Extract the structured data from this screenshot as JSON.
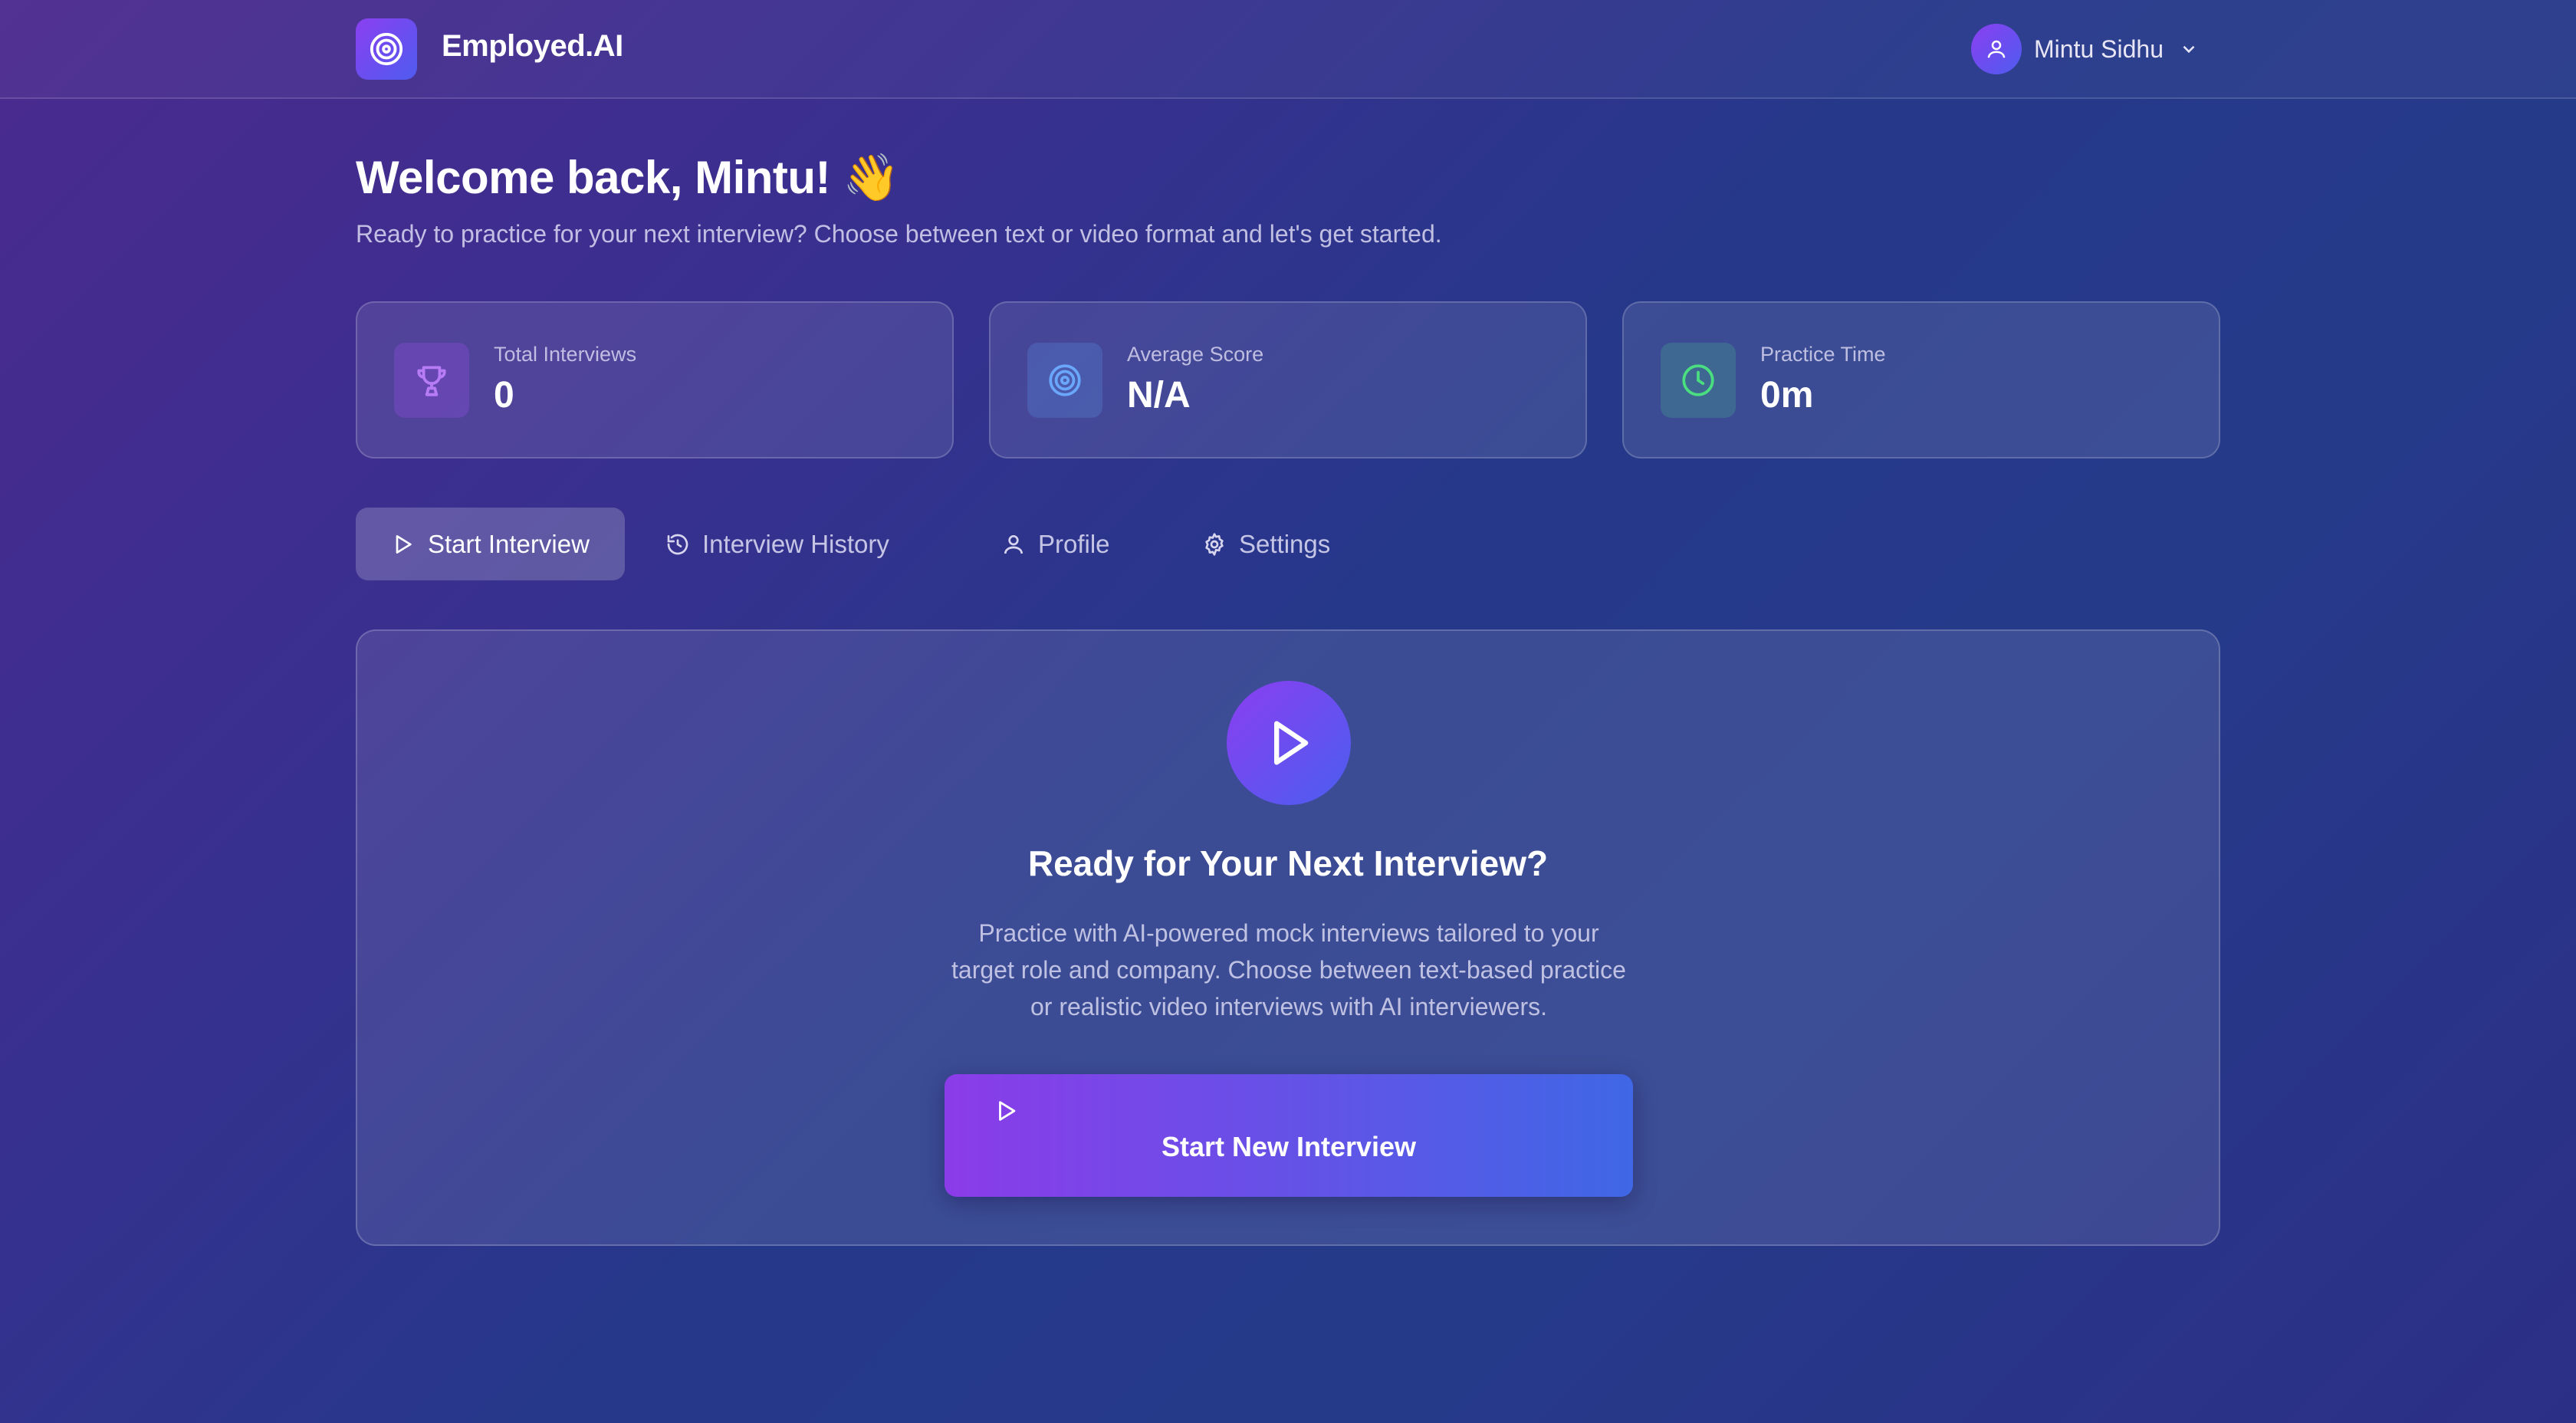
{
  "header": {
    "brand": "Employed.AI",
    "logo_icon": "target-icon",
    "user_name": "Mintu Sidhu",
    "user_icon": "user-icon",
    "menu_icon": "chevron-down-icon"
  },
  "welcome": {
    "title": "Welcome back, Mintu! 👋",
    "subtitle": "Ready to practice for your next interview? Choose between text or video format and let's get started."
  },
  "stats": [
    {
      "label": "Total Interviews",
      "value": "0",
      "icon": "trophy-icon",
      "color": "#a855f7"
    },
    {
      "label": "Average Score",
      "value": "N/A",
      "icon": "target-icon",
      "color": "#60a5fa"
    },
    {
      "label": "Practice Time",
      "value": "0m",
      "icon": "clock-icon",
      "color": "#4ade80"
    }
  ],
  "tabs": [
    {
      "label": "Start Interview",
      "icon": "play-icon",
      "active": true
    },
    {
      "label": "Interview History",
      "icon": "history-icon",
      "active": false
    },
    {
      "label": "Profile",
      "icon": "user-icon",
      "active": false
    },
    {
      "label": "Settings",
      "icon": "gear-icon",
      "active": false
    }
  ],
  "panel": {
    "title": "Ready for Your Next Interview?",
    "description": "Practice with AI-powered mock interviews tailored to your target role and company. Choose between text-based practice or realistic video interviews with AI interviewers.",
    "button_label": "Start New Interview",
    "button_icon": "play-icon"
  },
  "colors": {
    "accent_purple": "#8b3ce8",
    "accent_blue": "#3f67e6"
  }
}
